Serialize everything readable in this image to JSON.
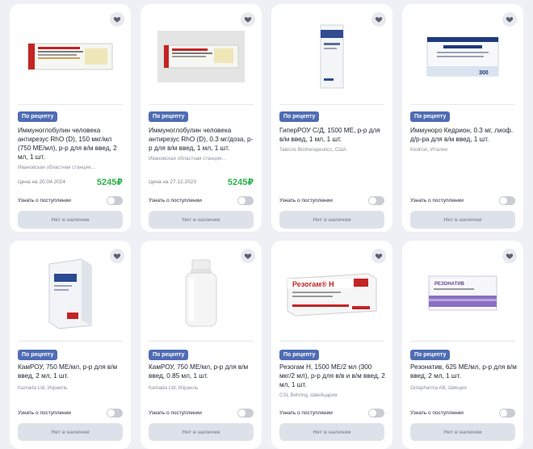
{
  "ui": {
    "badge": "По рецепту",
    "notify_label": "Узнать о поступлении",
    "unavailable_label": "Нет в наличии"
  },
  "products": [
    {
      "name": "Иммуноглобулин человека антирезус RhO (D), 150 мкг/мл (750 МЕ/мл), р-р для в/м введ, 2 мл, 1 шт.",
      "maker": "Ивановская областная станция…",
      "price_date": "Цена на 20.04.2024",
      "price": "5245₽",
      "box_text": "ИММУНОГЛОБУЛИН ЧЕЛОВЕКА АНТИРЕЗУС RhO(D)",
      "image": "red-white-carton"
    },
    {
      "name": "Иммуноглобулин человека антирезус RhO (D), 0.3 мг/доза, р-р для в/м введ, 1 мл, 1 шт.",
      "maker": "Ивановская областная станция…",
      "price_date": "Цена на 27.12.2023",
      "price": "5245₽",
      "box_text": "ИММУНОГЛОБУЛИН ЧЕЛОВЕКА АНТИРЕЗУС",
      "image": "red-white-carton-grey"
    },
    {
      "name": "ГиперРОУ С/Д, 1500 МЕ, р-р для в/м введ, 1 мл, 1 шт.",
      "maker": "Talecris Biotherapeutics, США",
      "price_date": "",
      "price": "",
      "box_text": "",
      "image": "tall-blue-white-box"
    },
    {
      "name": "Иммуноро Кедрион, 0.3 мг, лиоф. д/р-ра для в/м введ, 1 шт.",
      "maker": "Kedrion, Италия",
      "price_date": "",
      "price": "",
      "box_text": "300",
      "image": "white-blue-carton"
    },
    {
      "name": "КамРОУ, 750 МЕ/мл, р-р для в/м введ, 2 мл, 1 шт.",
      "maker": "Kamada Ltd, Израиль",
      "price_date": "",
      "price": "",
      "box_text": "",
      "image": "white-red-tall-box"
    },
    {
      "name": "КамРОУ, 750 МЕ/мл, р-р для в/м введ, 0.85 мл, 1 шт.",
      "maker": "Kamada Ltd, Израиль",
      "price_date": "",
      "price": "",
      "box_text": "",
      "image": "white-bottle"
    },
    {
      "name": "Резогам Н, 1500 МЕ/2 мл (300 мкг/2 мл), р-р для в/в и в/м введ, 2 мл, 1 шт.",
      "maker": "CSL Behring, Швейцария",
      "price_date": "",
      "price": "",
      "box_text": "Резогам® Н",
      "image": "red-white-long-box"
    },
    {
      "name": "Резонатив, 625 МЕ/мл, р-р для в/м введ, 2 мл, 1 шт.",
      "maker": "Octapharma AB, Швеция",
      "price_date": "",
      "price": "",
      "box_text": "РЕЗОНАТИВ",
      "image": "white-purple-carton"
    }
  ]
}
